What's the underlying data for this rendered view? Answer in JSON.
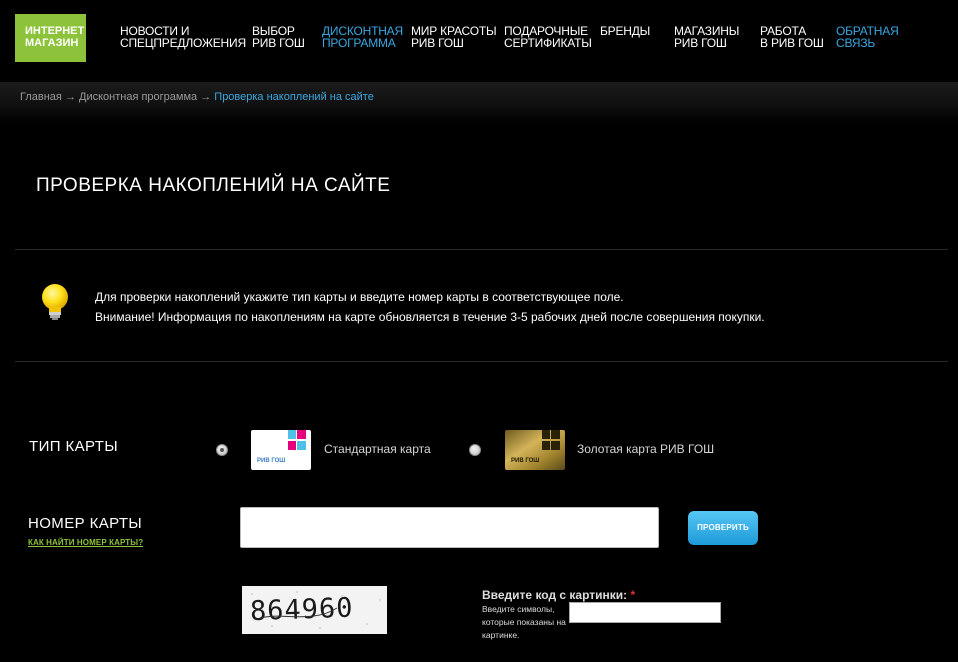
{
  "nav": {
    "shop": "ИНТЕРНЕТ\nМАГАЗИН",
    "items": [
      {
        "label": "НОВОСТИ И\nСПЕЦПРЕДЛОЖЕНИЯ"
      },
      {
        "label": "ВЫБОР\nРИВ ГОШ"
      },
      {
        "label": "ДИСКОНТНАЯ\nПРОГРАММА"
      },
      {
        "label": "МИР КРАСОТЫ\nРИВ ГОШ"
      },
      {
        "label": "ПОДАРОЧНЫЕ\nСЕРТИФИКАТЫ"
      },
      {
        "label": "БРЕНДЫ"
      },
      {
        "label": "МАГАЗИНЫ\nРИВ ГОШ"
      },
      {
        "label": "РАБОТА\nВ РИВ ГОШ"
      },
      {
        "label": "ОБРАТНАЯ\nСВЯЗЬ"
      }
    ],
    "active_color": "#3aa7e0",
    "shop_color": "#8dc33a"
  },
  "breadcrumb": {
    "home": "Главная",
    "section": "Дисконтная программа",
    "current": "Проверка накоплений на сайте",
    "separator": "→"
  },
  "page_title": "ПРОВЕРКА НАКОПЛЕНИЙ НА САЙТЕ",
  "info": {
    "icon": "lightbulb-icon",
    "line1": "Для проверки накоплений укажите тип карты и введите номер карты в соответствующее поле.",
    "line2": "Внимание! Информация по накоплениям на карте обновляется в течение 3-5 рабочих дней после совершения покупки."
  },
  "card_type": {
    "label": "ТИП КАРТЫ",
    "options": [
      {
        "label": "Стандартная карта",
        "logo_text": "РИВ ГОШ",
        "checked": true
      },
      {
        "label": "Золотая карта РИВ ГОШ",
        "logo_text": "РИВ ГОШ",
        "checked": false
      }
    ]
  },
  "card_number": {
    "label": "НОМЕР КАРТЫ",
    "help_link": "КАК НАЙТИ НОМЕР КАРТЫ?",
    "value": "",
    "button": "ПРОВЕРИТЬ"
  },
  "captcha": {
    "image_text": "864960",
    "title": "Введите код с картинки:",
    "required_mark": "*",
    "hint": "Введите символы, которые показаны на картинке.",
    "value": ""
  }
}
